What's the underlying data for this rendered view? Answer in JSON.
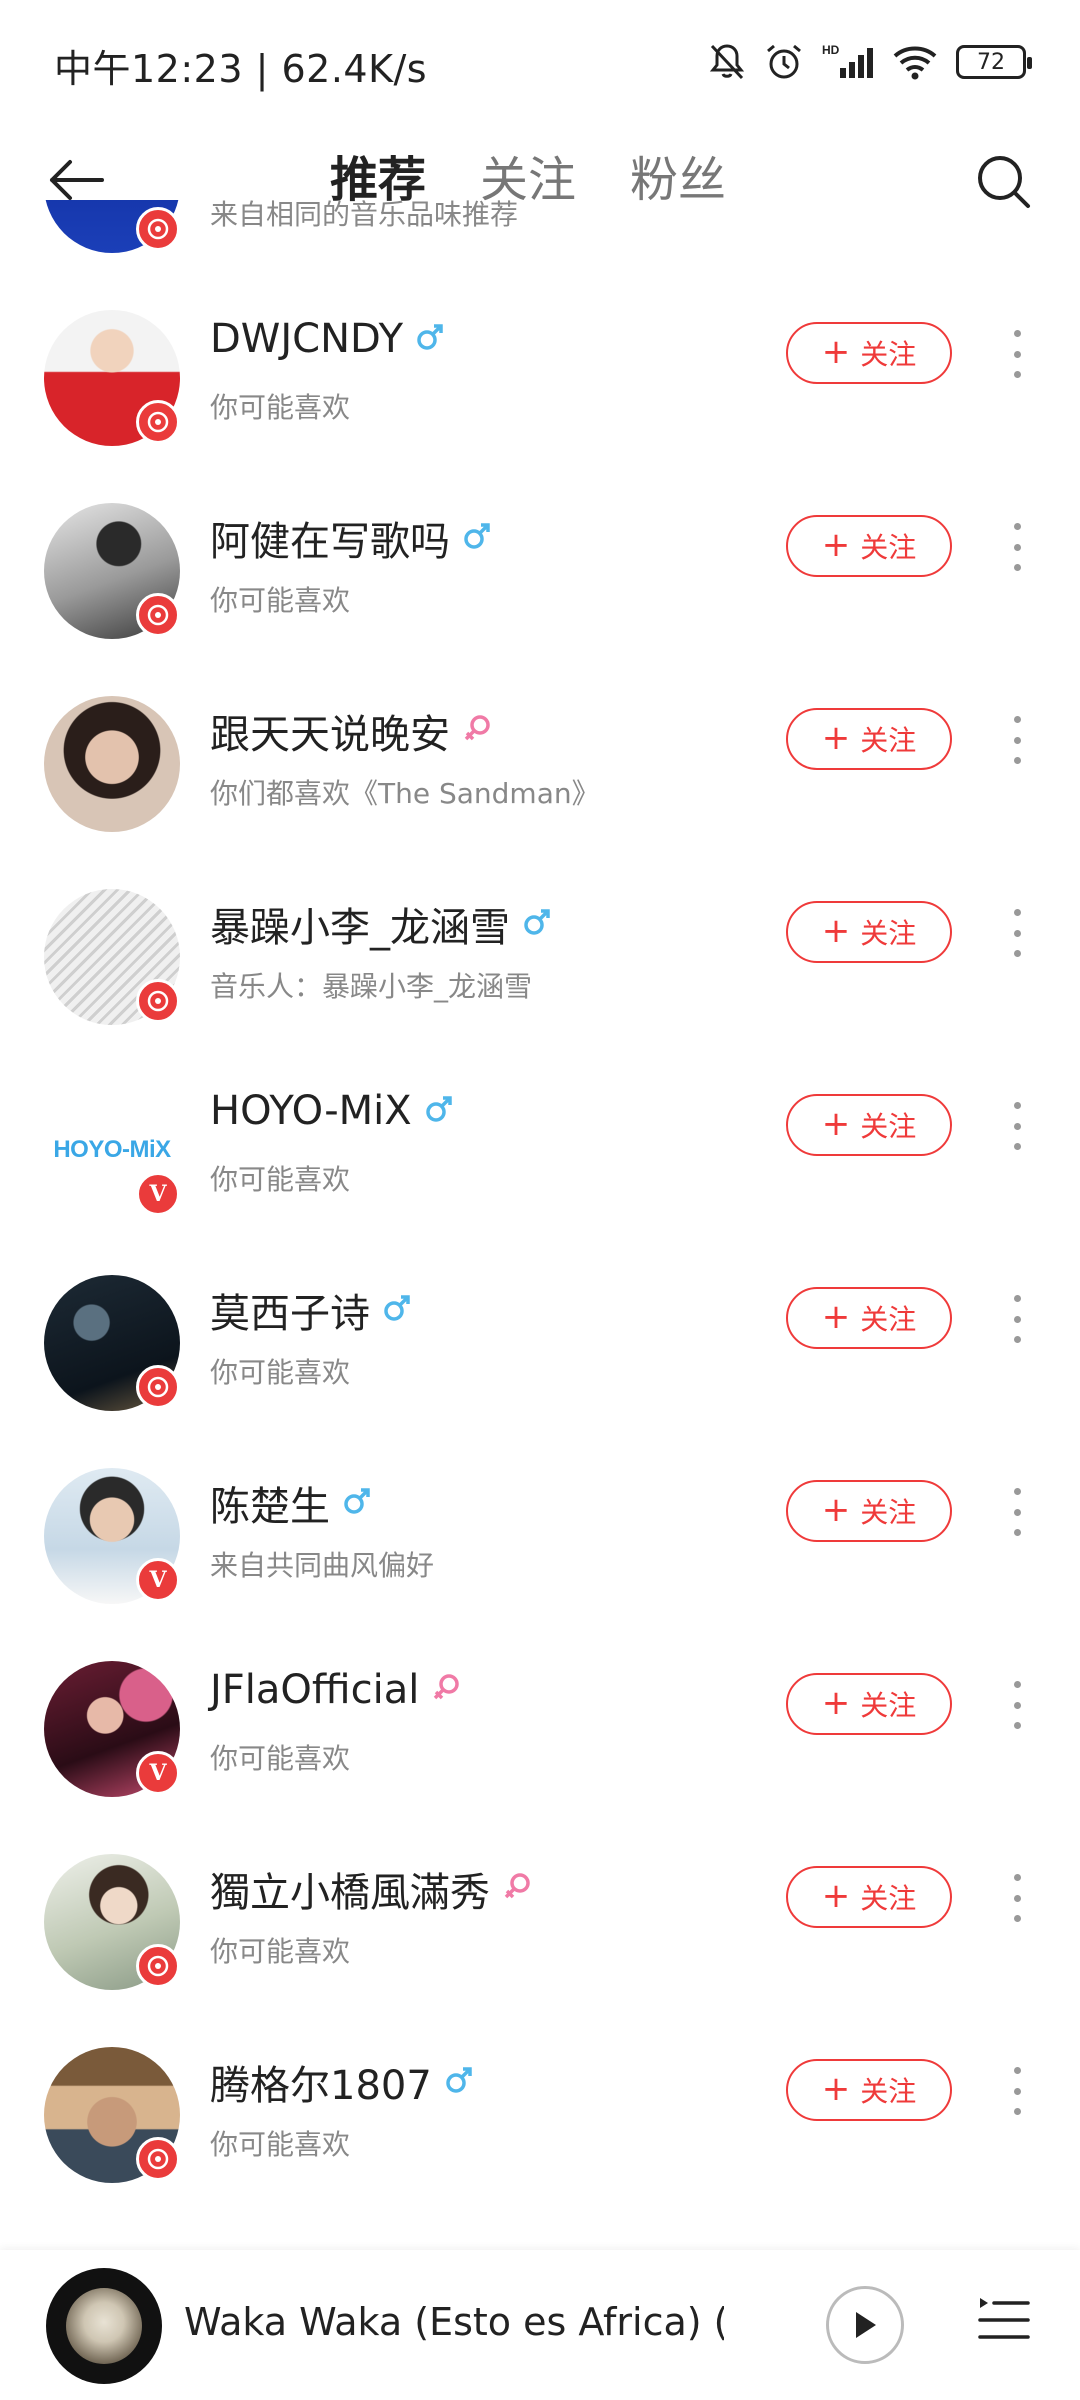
{
  "status_bar": {
    "time_speed": "中午12:23 | 62.4K/s",
    "battery": "72",
    "icons": [
      "mute-bell-icon",
      "alarm-icon",
      "hd-signal-icon",
      "wifi-icon",
      "battery-icon"
    ]
  },
  "header": {
    "back_icon": "back-arrow-icon",
    "tabs": [
      {
        "label": "推荐",
        "active": true
      },
      {
        "label": "关注",
        "active": false
      },
      {
        "label": "粉丝",
        "active": false
      }
    ],
    "search_icon": "search-icon"
  },
  "colors": {
    "accent": "#ef3a3a",
    "male": "#4fb6ea",
    "female": "#f07aa6"
  },
  "list": [
    {
      "name": "",
      "gender": "",
      "subtitle": "来自相同的音乐品味推荐",
      "badge": "music",
      "follow_label": "关注"
    },
    {
      "name": "DWJCNDY",
      "gender": "male",
      "subtitle": "你可能喜欢",
      "badge": "music",
      "follow_label": "关注"
    },
    {
      "name": "阿健在写歌吗",
      "gender": "male",
      "subtitle": "你可能喜欢",
      "badge": "music",
      "follow_label": "关注"
    },
    {
      "name": "跟天天说晚安",
      "gender": "female",
      "subtitle": "你们都喜欢《The Sandman》",
      "badge": "",
      "follow_label": "关注"
    },
    {
      "name": "暴躁小李_龙涵雪",
      "gender": "male",
      "subtitle": "音乐人：暴躁小李_龙涵雪",
      "badge": "music",
      "follow_label": "关注"
    },
    {
      "name": "HOYO-MiX",
      "gender": "male",
      "subtitle": "你可能喜欢",
      "badge": "V",
      "logo_text": "HOYO-MiX",
      "follow_label": "关注"
    },
    {
      "name": "莫西子诗",
      "gender": "male",
      "subtitle": "你可能喜欢",
      "badge": "music",
      "follow_label": "关注"
    },
    {
      "name": "陈楚生",
      "gender": "male",
      "subtitle": "来自共同曲风偏好",
      "badge": "V",
      "follow_label": "关注"
    },
    {
      "name": "JFlaOfficial",
      "gender": "female",
      "subtitle": "你可能喜欢",
      "badge": "V",
      "follow_label": "关注"
    },
    {
      "name": "獨立小橋風滿秀",
      "gender": "female",
      "subtitle": "你可能喜欢",
      "badge": "music",
      "follow_label": "关注"
    },
    {
      "name": "腾格尔1807",
      "gender": "male",
      "subtitle": "你可能喜欢",
      "badge": "music",
      "follow_label": "关注"
    }
  ],
  "player": {
    "song_title": "Waka Waka (Esto es Africa) (…",
    "play_icon": "play-icon",
    "playlist_icon": "playlist-icon"
  }
}
